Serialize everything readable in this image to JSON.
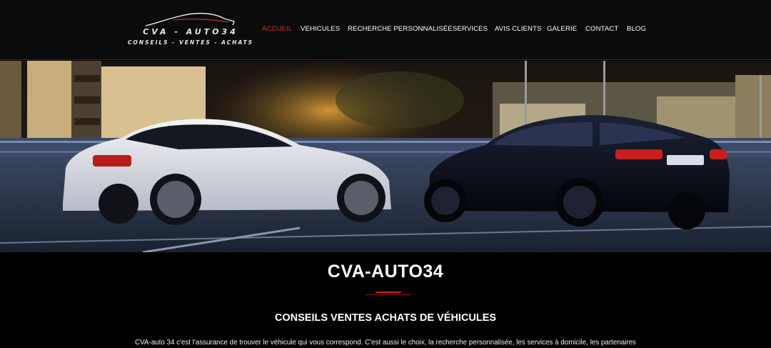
{
  "brand": {
    "name": "CVA - AUTO34",
    "tagline": "CONSEILS - VENTES - ACHATS"
  },
  "nav": {
    "items": [
      {
        "label": "ACCUEIL",
        "active": true
      },
      {
        "label": "VEHICULES",
        "active": false
      },
      {
        "label": "RECHERCHE PERSONNALISÉE",
        "active": false
      },
      {
        "label": "SERVICES",
        "active": false
      },
      {
        "label": "AVIS CLIENTS",
        "active": false
      },
      {
        "label": "GALERIE",
        "active": false
      },
      {
        "label": "CONTACT",
        "active": false
      },
      {
        "label": "BLOG",
        "active": false
      }
    ]
  },
  "main": {
    "title": "CVA-AUTO34",
    "subtitle": "CONSEILS VENTES ACHATS DE VÉHICULES",
    "intro": "CVA-auto 34 c'est l'assurance de trouver le véhicule qui vous correspond. C'est aussi le choix, la recherche personnalisée, les services à domicile, les partenaires"
  },
  "colors": {
    "accent": "#d62b2b",
    "header_bg": "#0b0b0b",
    "page_bg": "#000000"
  }
}
